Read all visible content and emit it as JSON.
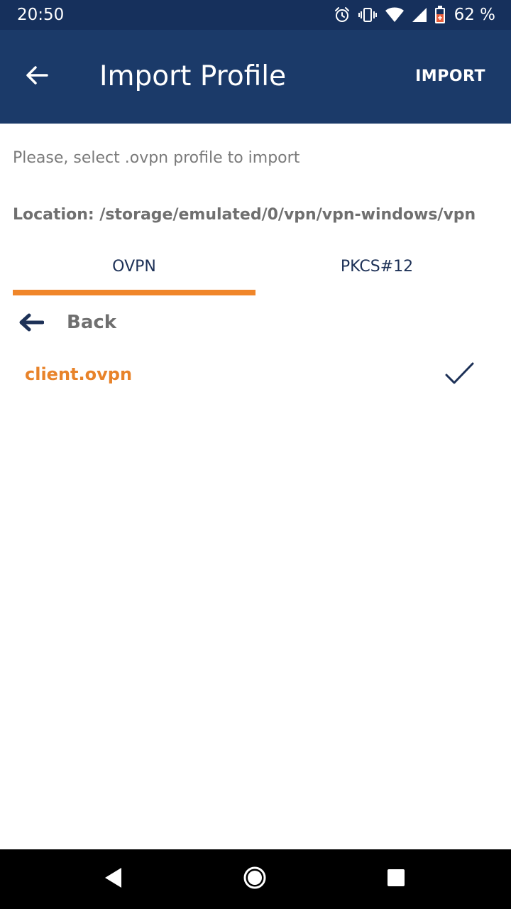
{
  "status_bar": {
    "time": "20:50",
    "battery_percent": "62 %",
    "icons": [
      "alarm-icon",
      "vibrate-icon",
      "wifi-icon",
      "signal-icon",
      "battery-icon"
    ]
  },
  "app_bar": {
    "back_icon": "arrow-left-icon",
    "title": "Import Profile",
    "action_label": "IMPORT"
  },
  "content": {
    "instruction": "Please, select .ovpn profile to import",
    "location_label": "Location:",
    "location_path": "/storage/emulated/0/vpn/vpn-windows/vpn"
  },
  "tabs": [
    {
      "label": "OVPN",
      "selected": true
    },
    {
      "label": "PKCS#12",
      "selected": false
    }
  ],
  "file_list": {
    "back_label": "Back",
    "files": [
      {
        "name": "client.ovpn",
        "selected": true
      }
    ]
  },
  "colors": {
    "status_bar": "#16305c",
    "app_bar": "#1b3a69",
    "accent": "#f0862a",
    "file_name": "#e8832a",
    "navy": "#1d3157"
  },
  "nav_bar": {
    "icons": [
      "back-triangle-icon",
      "home-circle-icon",
      "recents-square-icon"
    ]
  }
}
